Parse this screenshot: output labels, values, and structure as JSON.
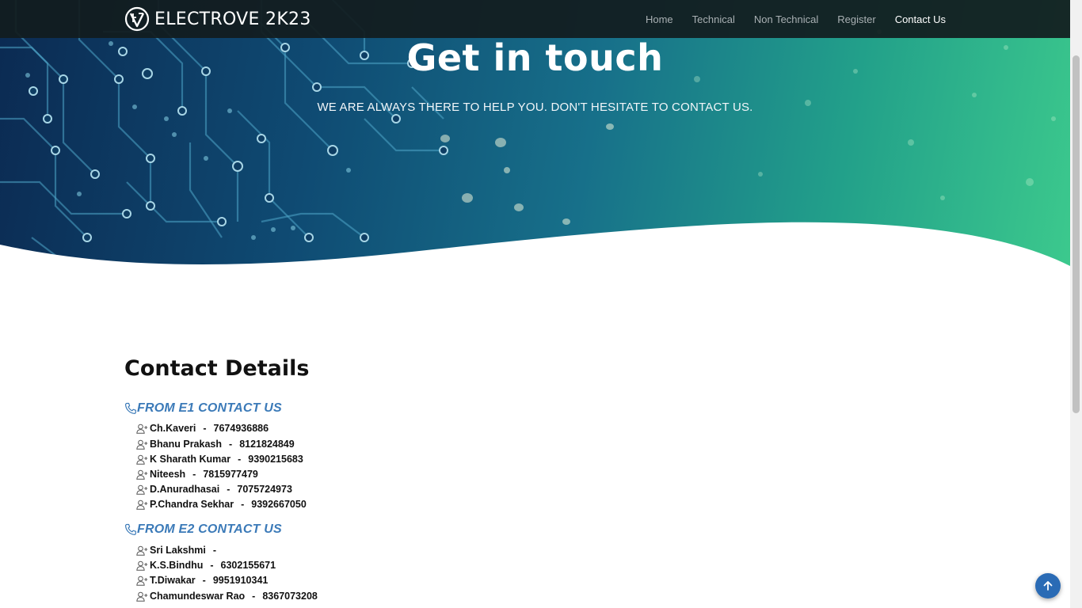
{
  "brand": {
    "name": "ELECTROVE 2K23",
    "logo_icon": "ev-logo-icon"
  },
  "nav": {
    "items": [
      {
        "label": "Home"
      },
      {
        "label": "Technical"
      },
      {
        "label": "Non Technical"
      },
      {
        "label": "Register"
      },
      {
        "label": "Contact Us",
        "active": true
      }
    ]
  },
  "hero": {
    "title": "Get in touch",
    "subtitle": "WE ARE ALWAYS THERE TO HELP YOU. DON'T HESITATE TO CONTACT US."
  },
  "contact": {
    "title": "Contact Details",
    "groups": [
      {
        "heading": "FROM E1 CONTACT US",
        "icon": "phone-icon",
        "people": [
          {
            "name": "Ch.Kaveri",
            "phone": "7674936886"
          },
          {
            "name": "Bhanu Prakash",
            "phone": "8121824849"
          },
          {
            "name": "K Sharath Kumar",
            "phone": "9390215683"
          },
          {
            "name": "Niteesh",
            "phone": "7815977479"
          },
          {
            "name": "D.Anuradhasai",
            "phone": "7075724973"
          },
          {
            "name": "P.Chandra Sekhar",
            "phone": "9392667050"
          }
        ]
      },
      {
        "heading": "FROM E2 CONTACT US",
        "icon": "phone-icon",
        "people": [
          {
            "name": "Sri Lakshmi",
            "phone": ""
          },
          {
            "name": "K.S.Bindhu",
            "phone": "6302155671"
          },
          {
            "name": "T.Diwakar",
            "phone": "9951910341"
          },
          {
            "name": "Chamundeswar Rao",
            "phone": "8367073208"
          }
        ]
      }
    ],
    "separator": "-"
  },
  "colors": {
    "accent": "#3b7ab8",
    "navbar": "#121c1e",
    "to_top_button": "#2a6bb5"
  },
  "to_top": {
    "icon": "arrow-up-icon"
  }
}
